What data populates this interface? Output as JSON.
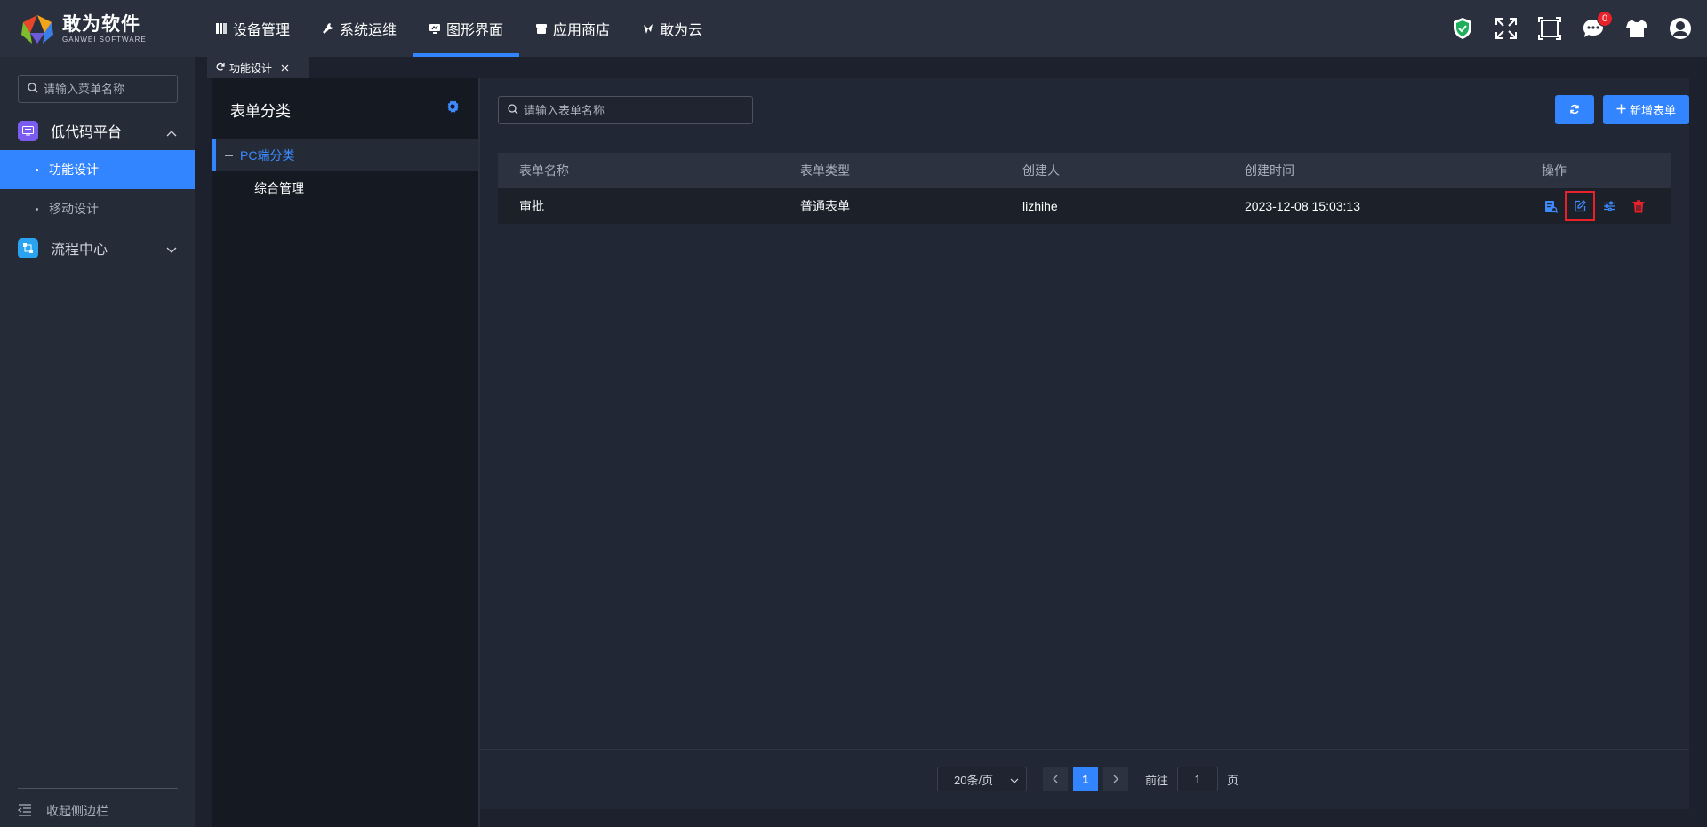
{
  "brand": {
    "title": "敢为软件",
    "subtitle": "GANWEI SOFTWARE"
  },
  "nav": {
    "items": [
      {
        "label": "设备管理",
        "icon": "book-icon"
      },
      {
        "label": "系统运维",
        "icon": "wrench-icon"
      },
      {
        "label": "图形界面",
        "icon": "monitor-icon",
        "active": true
      },
      {
        "label": "应用商店",
        "icon": "store-icon"
      },
      {
        "label": "敢为云",
        "icon": "cloud-icon"
      }
    ]
  },
  "topicons": {
    "shield": "shield-icon",
    "fullscreen": "fullscreen-icon",
    "screen": "screen-frame-icon",
    "messages": "message-icon",
    "message_count": "0",
    "theme": "tshirt-icon",
    "avatar": "avatar-icon"
  },
  "sidebar": {
    "search_placeholder": "请输入菜单名称",
    "groups": [
      {
        "label": "低代码平台",
        "icon": "lowcode-icon",
        "expanded": true,
        "children": [
          {
            "label": "功能设计",
            "active": true
          },
          {
            "label": "移动设计",
            "active": false
          }
        ]
      },
      {
        "label": "流程中心",
        "icon": "flow-icon",
        "expanded": false
      }
    ],
    "collapse_label": "收起侧边栏"
  },
  "tabs": [
    {
      "label": "功能设计"
    }
  ],
  "category": {
    "title": "表单分类",
    "tree": [
      {
        "label": "PC端分类",
        "selected": true,
        "children": [
          {
            "label": "综合管理"
          }
        ]
      }
    ]
  },
  "main": {
    "search_placeholder": "请输入表单名称",
    "new_button": "新增表单",
    "table": {
      "headers": [
        "表单名称",
        "表单类型",
        "创建人",
        "创建时间",
        "操作"
      ],
      "rows": [
        {
          "name": "审批",
          "type": "普通表单",
          "creator": "lizhihe",
          "created": "2023-12-08 15:03:13"
        }
      ],
      "row_actions": [
        "preview-icon",
        "edit-icon",
        "settings-sliders-icon",
        "trash-icon"
      ]
    },
    "pagination": {
      "page_size": "20条/页",
      "current_page": "1",
      "goto_label": "前往",
      "goto_value": "1",
      "page_suffix": "页"
    }
  },
  "colors": {
    "accent": "#3385ff",
    "danger": "#e8212b",
    "topbar": "#2a303d",
    "sidebar": "#252b37",
    "main": "#212734"
  }
}
